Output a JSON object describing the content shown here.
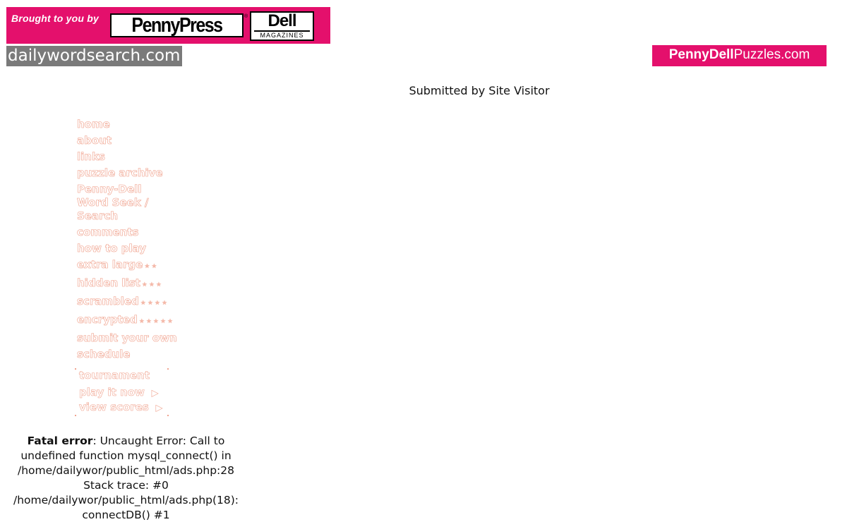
{
  "sponsor": {
    "brought_by": "Brought to you by",
    "pennypress_logo": "PennyPress",
    "registered_mark": "®",
    "dell_logo": "Dell",
    "dell_sub": "MAGAZINES"
  },
  "site_logo": "dailywordsearch.com",
  "partner_logo": {
    "part1": "PennyDell",
    "part2": "Puzzles.com"
  },
  "submitted_by": "Submitted by Site Visitor",
  "nav": {
    "home": "home",
    "about": "about",
    "links": "links",
    "puzzle_archive": "puzzle archive",
    "penny_dell": "Penny-Dell Word Seek / Search",
    "comments": "comments",
    "how_to_play": "how to play",
    "extra_large": "extra large",
    "extra_large_stars": "★★",
    "hidden_list": "hidden list",
    "hidden_list_stars": "★★★",
    "scrambled": "scrambled",
    "scrambled_stars": "★★★★",
    "encrypted": "encrypted",
    "encrypted_stars": "★★★★★",
    "submit_your_own": "submit your own",
    "schedule": "schedule"
  },
  "tournament": {
    "title": "tournament",
    "play_it_now": "play it now",
    "view_scores": "view scores",
    "arrow": "▶"
  },
  "error": {
    "label": "Fatal error",
    "message": ": Uncaught Error: Call to undefined function mysql_connect() in /home/dailywor/public_html/ads.php:28 Stack trace: #0 /home/dailywor/public_html/ads.php(18): connectDB() #1"
  },
  "colors": {
    "brand_pink": "#e4106c",
    "logo_gray": "#7a7a7a",
    "nav_outline": "#f0a490"
  }
}
